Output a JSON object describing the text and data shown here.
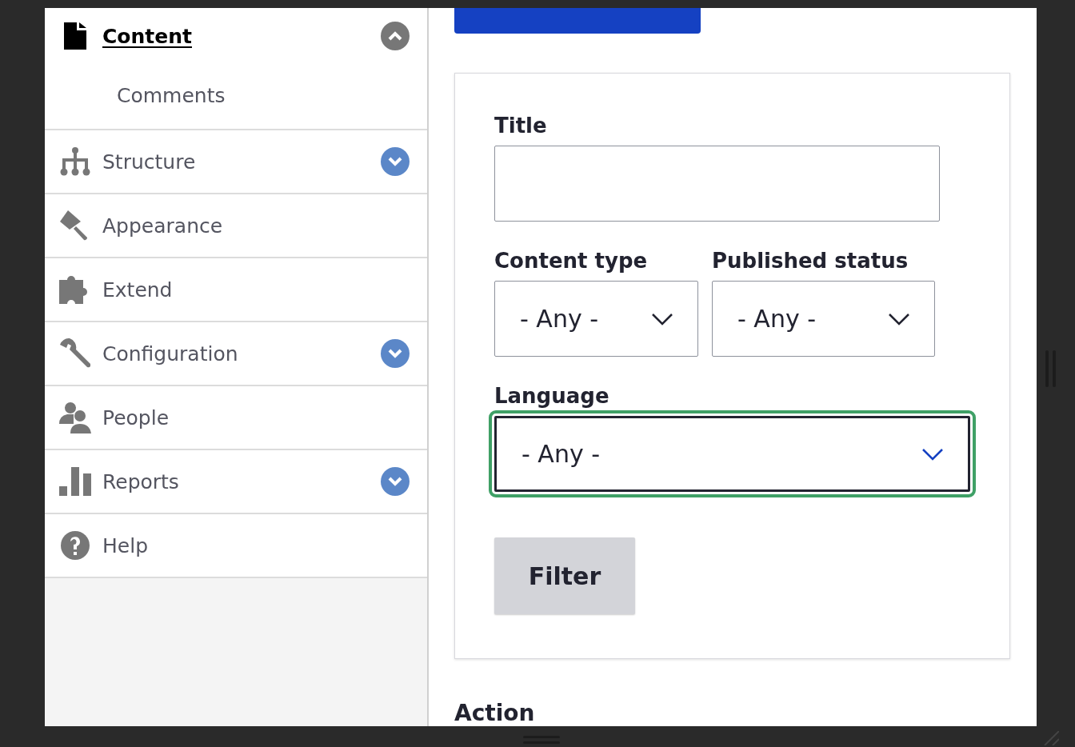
{
  "sidebar": {
    "items": [
      {
        "label": "Content",
        "kind": "toggle",
        "selected": true,
        "expanded": true,
        "children": [
          {
            "label": "Comments"
          }
        ]
      },
      {
        "label": "Structure",
        "kind": "toggle",
        "selected": false,
        "expanded": false
      },
      {
        "label": "Appearance",
        "kind": "link",
        "selected": false
      },
      {
        "label": "Extend",
        "kind": "link",
        "selected": false
      },
      {
        "label": "Configuration",
        "kind": "toggle",
        "selected": false,
        "expanded": false
      },
      {
        "label": "People",
        "kind": "link",
        "selected": false
      },
      {
        "label": "Reports",
        "kind": "toggle",
        "selected": false,
        "expanded": false
      },
      {
        "label": "Help",
        "kind": "link",
        "selected": false
      }
    ]
  },
  "filters": {
    "title": {
      "label": "Title"
    },
    "selects": [
      {
        "label": "Content type",
        "value": "- Any -",
        "focused": false
      },
      {
        "label": "Published status",
        "value": "- Any -",
        "focused": false
      }
    ],
    "language": {
      "label": "Language",
      "value": "- Any -",
      "focused": true
    },
    "button": "Filter"
  },
  "section_heading": "Action"
}
